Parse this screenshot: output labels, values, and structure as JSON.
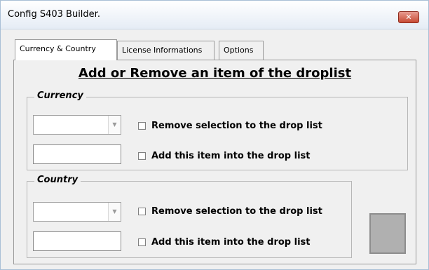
{
  "window": {
    "title": "Config S403 Builder.",
    "close_glyph": "✕"
  },
  "tabs": [
    {
      "label": "Currency & Country",
      "active": true
    },
    {
      "label": "License Informations",
      "active": false
    },
    {
      "label": "Options",
      "active": false
    }
  ],
  "panel": {
    "heading": "Add or Remove an item of the droplist",
    "currency": {
      "label": "Currency",
      "combo_value": "",
      "remove_label": "Remove selection to the drop list",
      "input_value": "",
      "add_label": "Add this item into the drop list"
    },
    "country": {
      "label": "Country",
      "combo_value": "",
      "remove_label": "Remove selection to the drop list",
      "input_value": "",
      "add_label": "Add this item into the drop list"
    }
  },
  "icons": {
    "combo_arrow": "▼"
  }
}
